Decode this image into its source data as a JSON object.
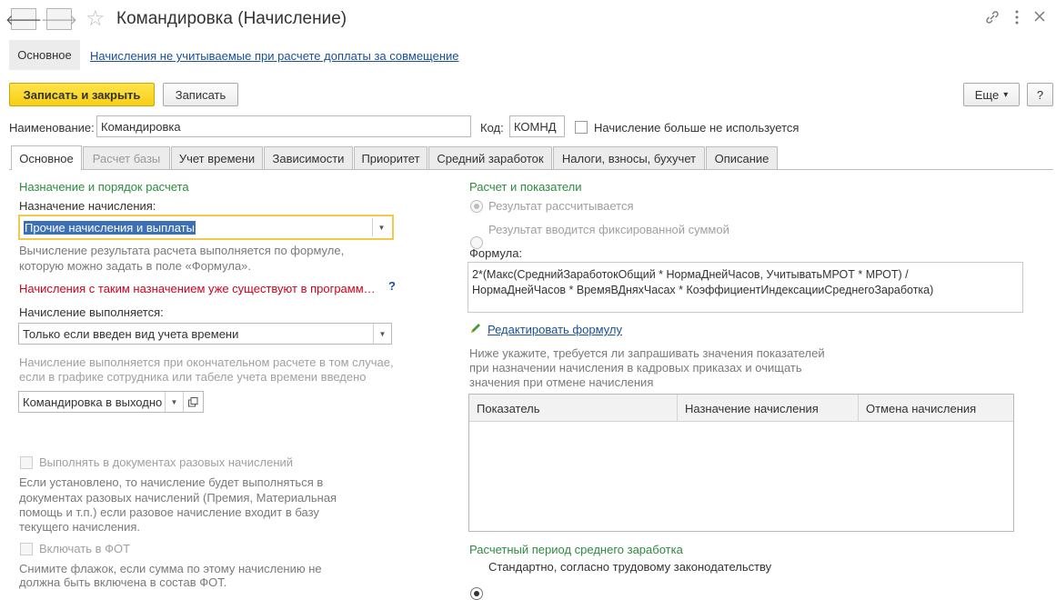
{
  "window": {
    "title": "Командировка (Начисление)",
    "more_icon": "vertical-dots-icon",
    "link_icon": "link-icon",
    "close_icon": "close-icon"
  },
  "nav": {
    "back": "🡐",
    "forward": "🡒",
    "favorite": "☆"
  },
  "sections": {
    "main_label": "Основное",
    "link_label": "Начисления не учитываемые при расчете доплаты за совмещение"
  },
  "toolbar": {
    "save_close": "Записать и закрыть",
    "save": "Записать",
    "more": "Еще",
    "more_arrow": "▾",
    "help": "?"
  },
  "form": {
    "name_label": "Наименование:",
    "name_value": "Командировка",
    "code_label": "Код:",
    "code_value": "КОМНД",
    "not_used_label": "Начисление больше не используется"
  },
  "tabs": [
    {
      "label": "Основное"
    },
    {
      "label": "Расчет базы"
    },
    {
      "label": "Учет времени"
    },
    {
      "label": "Зависимости"
    },
    {
      "label": "Приоритет"
    },
    {
      "label": "Средний заработок"
    },
    {
      "label": "Налоги, взносы, бухучет"
    },
    {
      "label": "Описание"
    }
  ],
  "left": {
    "section_title": "Назначение и порядок расчета",
    "purpose_label": "Назначение начисления:",
    "purpose_value": "Прочие начисления и выплаты",
    "purpose_hint_1": "Вычисление результата расчета выполняется по формуле,",
    "purpose_hint_2": "которую можно задать в поле «Формула».",
    "warning": "Начисления с таким назначением уже существуют в программ…",
    "warning_help": "?",
    "executed_label": "Начисление выполняется:",
    "executed_value": "Только если введен вид учета времени",
    "executed_hint_1": "Начисление выполняется при окончательном расчете в том случае,",
    "executed_hint_2": "если в графике сотрудника или табеле учета времени введено",
    "time_kind_value": "Командировка в выходно",
    "one_time_label": "Выполнять в документах разовых начислений",
    "one_time_hint_1": "Если установлено, то начисление будет выполняться в",
    "one_time_hint_2": "документах разовых начислений (Премия, Материальная",
    "one_time_hint_3": "помощь и т.п.) если разовое начисление входит в базу",
    "one_time_hint_4": "текущего начисления.",
    "fot_label": "Включать в ФОТ",
    "fot_hint_1": "Снимите флажок, если сумма по этому начислению не",
    "fot_hint_2": "должна быть включена в состав ФОТ."
  },
  "right": {
    "section_title": "Расчет и показатели",
    "radio_calculated": "Результат рассчитывается",
    "radio_fixed": "Результат вводится фиксированной суммой",
    "formula_label": "Формула:",
    "formula_line_1": "2*(Макс(СреднийЗаработокОбщий * НормаДнейЧасов, УчитыватьМРОТ * МРОТ) /",
    "formula_line_2": "НормаДнейЧасов * ВремяВДняхЧасах * КоэффициентИндексацииСреднегоЗаработка)",
    "edit_formula": "Редактировать формулу",
    "indicators_hint_1": "Ниже укажите, требуется ли запрашивать значения показателей",
    "indicators_hint_2": "при назначении начисления в кадровых приказах и очищать",
    "indicators_hint_3": "значения при отмене начисления",
    "table_headers": [
      "Показатель",
      "Назначение начисления",
      "Отмена начисления"
    ],
    "period_title": "Расчетный период среднего заработка",
    "period_standard": "Стандартно, согласно трудовому законодательству"
  },
  "colors": {
    "accent_yellow": "#f7cf13",
    "section_green": "#2e8b3d",
    "warning_red": "#d0021b",
    "link_blue": "#1a4f99"
  }
}
